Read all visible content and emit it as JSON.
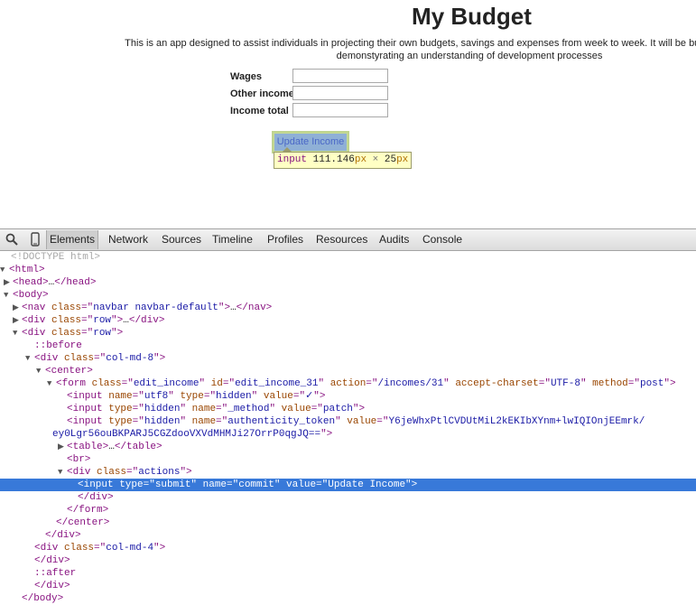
{
  "page": {
    "title": "My Budget",
    "description_line1": "This is an app designed to assist individuals in projecting their own budgets, savings and expenses from week to week. It will be built with Ruby on Rails, custo",
    "description_line2": "demonstyrating an understanding of development processes",
    "form": {
      "rows": [
        {
          "label": "Wages",
          "value": ""
        },
        {
          "label": "Other income",
          "value": ""
        },
        {
          "label": "Income total",
          "value": ""
        }
      ],
      "submit_label": "Update Income"
    },
    "tooltip": {
      "tag": "input",
      "width": "111.146",
      "height": "25",
      "unit": "px",
      "sep": "×"
    }
  },
  "devtools": {
    "tabs": [
      "Elements",
      "Network",
      "Sources",
      "Timeline",
      "Profiles",
      "Resources",
      "Audits",
      "Console"
    ],
    "active_tab": "Elements",
    "tree": [
      {
        "tri": "",
        "html": "<span class='g'>&lt;!DOCTYPE html&gt;</span>"
      },
      {
        "tri": "▼",
        "html": "<span class='t'>&lt;html&gt;</span>"
      },
      {
        "tri": "▶",
        "html": "<span class='t'>&lt;head&gt;</span>…<span class='t'>&lt;/head&gt;</span>"
      },
      {
        "tri": "▼",
        "html": "<span class='t'>&lt;body&gt;</span>"
      },
      {
        "tri": "▶",
        "html": "<span class='t'>&lt;nav </span><span class='a'>class</span><span class='t'>=\"</span><span class='v'>navbar navbar-default</span><span class='t'>\"&gt;</span>…<span class='t'>&lt;/nav&gt;</span>"
      },
      {
        "tri": "▶",
        "html": "<span class='t'>&lt;div </span><span class='a'>class</span><span class='t'>=\"</span><span class='v'>row</span><span class='t'>\"&gt;</span>…<span class='t'>&lt;/div&gt;</span>"
      },
      {
        "tri": "▼",
        "html": "<span class='t'>&lt;div </span><span class='a'>class</span><span class='t'>=\"</span><span class='v'>row</span><span class='t'>\"&gt;</span>"
      },
      {
        "tri": "",
        "html": "<span class='p'>::before</span>"
      },
      {
        "tri": "▼",
        "html": "<span class='t'>&lt;div </span><span class='a'>class</span><span class='t'>=\"</span><span class='v'>col-md-8</span><span class='t'>\"&gt;</span>"
      },
      {
        "tri": "▼",
        "html": "<span class='t'>&lt;center&gt;</span>"
      },
      {
        "tri": "▼",
        "html": "<span class='t'>&lt;form </span><span class='a'>class</span><span class='t'>=\"</span><span class='v'>edit_income</span><span class='t'>\" </span><span class='a'>id</span><span class='t'>=\"</span><span class='v'>edit_income_31</span><span class='t'>\" </span><span class='a'>action</span><span class='t'>=\"</span><span class='v'>/incomes/31</span><span class='t'>\" </span><span class='a'>accept-charset</span><span class='t'>=\"</span><span class='v'>UTF-8</span><span class='t'>\" </span><span class='a'>method</span><span class='t'>=\"</span><span class='v'>post</span><span class='t'>\"&gt;</span>"
      },
      {
        "tri": "",
        "html": "<span class='t'>&lt;input </span><span class='a'>name</span><span class='t'>=\"</span><span class='v'>utf8</span><span class='t'>\" </span><span class='a'>type</span><span class='t'>=\"</span><span class='v'>hidden</span><span class='t'>\" </span><span class='a'>value</span><span class='t'>=\"</span><span class='v'>✓</span><span class='t'>\"&gt;</span>"
      },
      {
        "tri": "",
        "html": "<span class='t'>&lt;input </span><span class='a'>type</span><span class='t'>=\"</span><span class='v'>hidden</span><span class='t'>\" </span><span class='a'>name</span><span class='t'>=\"</span><span class='v'>_method</span><span class='t'>\" </span><span class='a'>value</span><span class='t'>=\"</span><span class='v'>patch</span><span class='t'>\"&gt;</span>"
      },
      {
        "tri": "",
        "html": "<span class='t'>&lt;input </span><span class='a'>type</span><span class='t'>=\"</span><span class='v'>hidden</span><span class='t'>\" </span><span class='a'>name</span><span class='t'>=\"</span><span class='v'>authenticity_token</span><span class='t'>\" </span><span class='a'>value</span><span class='t'>=\"</span><span class='v'>Y6jeWhxPtlCVDUtMiL2kEKIbXYnm+lwIQIOnjEEmrk/</span>"
      },
      {
        "tri": "",
        "html": "<span class='v'>ey0Lgr56ouBKPARJ5CGZdooVXVdMHMJi27OrrP0qgJQ==</span><span class='t'>\"&gt;</span>"
      },
      {
        "tri": "▶",
        "html": "<span class='t'>&lt;table&gt;</span>…<span class='t'>&lt;/table&gt;</span>"
      },
      {
        "tri": "",
        "html": "<span class='t'>&lt;br&gt;</span>"
      },
      {
        "tri": "▼",
        "html": "<span class='t'>&lt;div </span><span class='a'>class</span><span class='t'>=\"</span><span class='v'>actions</span><span class='t'>\"&gt;</span>"
      },
      {
        "tri": "",
        "html": "<span>&lt;input type=\"submit\" name=\"commit\" value=\"Update Income\"&gt;</span>",
        "selected": true
      },
      {
        "tri": "",
        "html": "<span class='t'>&lt;/div&gt;</span>"
      },
      {
        "tri": "",
        "html": "<span class='t'>&lt;/form&gt;</span>"
      },
      {
        "tri": "",
        "html": "<span class='t'>&lt;/center&gt;</span>"
      },
      {
        "tri": "",
        "html": "<span class='t'>&lt;/div&gt;</span>"
      },
      {
        "tri": "",
        "html": "<span class='t'>&lt;div </span><span class='a'>class</span><span class='t'>=\"</span><span class='v'>col-md-4</span><span class='t'>\"&gt;</span>"
      },
      {
        "tri": "",
        "html": "<span class='t'>&lt;/div&gt;</span>"
      },
      {
        "tri": "",
        "html": "<span class='p'>::after</span>"
      },
      {
        "tri": "",
        "html": "<span class='t'>&lt;/div&gt;</span>"
      },
      {
        "tri": "",
        "html": "<span class='t'>&lt;/body&gt;</span>"
      }
    ]
  }
}
